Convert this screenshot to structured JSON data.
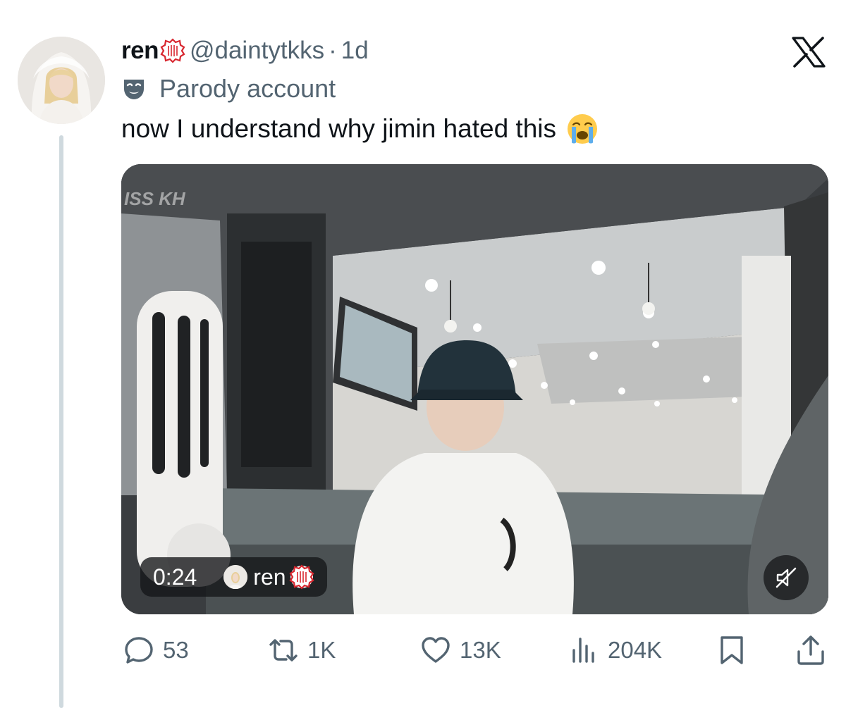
{
  "author": {
    "display_name": "ren",
    "handle": "@daintytkks",
    "separator": "·",
    "time_ago": "1d",
    "label_text": "Parody account"
  },
  "tweet": {
    "text": "now I understand why jimin hated this"
  },
  "media": {
    "type": "video",
    "timestamp": "0:24",
    "uploader_name": "ren",
    "muted": true,
    "watermark": "ISS KH"
  },
  "actions": {
    "replies": "53",
    "reposts": "1K",
    "likes": "13K",
    "views": "204K"
  },
  "icons": {
    "platform": "x-logo-icon",
    "label": "theater-mask-icon",
    "emoji": "loudly-crying-face-icon",
    "badge": "red-seal-badge-icon"
  },
  "colors": {
    "text": "#0f1419",
    "secondary": "#536471",
    "thread_line": "#cfd9de",
    "badge_red": "#d8262e"
  }
}
